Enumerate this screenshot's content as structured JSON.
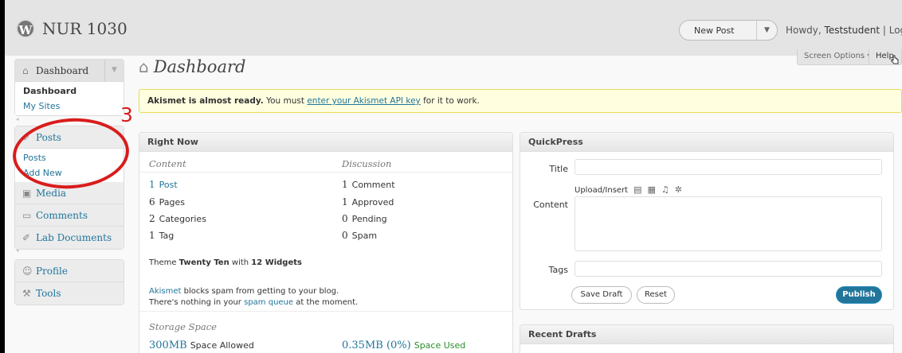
{
  "header": {
    "logo_glyph": "W",
    "site_name": "NUR 1030",
    "new_post_label": "New Post",
    "howdy_prefix": "Howdy, ",
    "username": "Teststudent",
    "logout_text": " | Log Ou"
  },
  "screen_options_label": "Screen Options ▾",
  "help_label": "Help",
  "sidebar": {
    "dashboard_label": "Dashboard",
    "dashboard_sub": [
      "Dashboard",
      "My Sites"
    ],
    "posts_label": "Posts",
    "posts_sub": [
      "Posts",
      "Add New"
    ],
    "media_label": "Media",
    "comments_label": "Comments",
    "lab_documents_label": "Lab Documents",
    "profile_label": "Profile",
    "tools_label": "Tools"
  },
  "page_title": "Dashboard",
  "notice": {
    "bold": "Akismet is almost ready.",
    "text1": " You must ",
    "link": "enter your Akismet API key",
    "text2": " for it to work."
  },
  "right_now": {
    "title": "Right Now",
    "content_heading": "Content",
    "discussion_heading": "Discussion",
    "content": [
      {
        "n": "1",
        "label": "Post"
      },
      {
        "n": "6",
        "label": "Pages"
      },
      {
        "n": "2",
        "label": "Categories"
      },
      {
        "n": "1",
        "label": "Tag"
      }
    ],
    "discussion": [
      {
        "n": "1",
        "label": "Comment"
      },
      {
        "n": "1",
        "label": "Approved"
      },
      {
        "n": "0",
        "label": "Pending"
      },
      {
        "n": "0",
        "label": "Spam"
      }
    ],
    "theme_prefix": "Theme ",
    "theme_name": "Twenty Ten",
    "theme_mid": " with ",
    "widgets": "12 Widgets",
    "akismet_link": "Akismet",
    "akismet_text": " blocks spam from getting to your blog.",
    "spam_line_pre": "There's nothing in your ",
    "spam_link": "spam queue",
    "spam_line_post": " at the moment.",
    "storage_heading": "Storage Space",
    "storage_allowed_n": "300MB",
    "storage_allowed_label": "Space Allowed",
    "storage_used_n": "0.35MB (0%)",
    "storage_used_label": "Space Used"
  },
  "quickpress": {
    "title": "QuickPress",
    "title_label": "Title",
    "upload_label": "Upload/Insert",
    "content_label": "Content",
    "tags_label": "Tags",
    "save_draft": "Save Draft",
    "reset": "Reset",
    "publish": "Publish"
  },
  "recent_drafts": {
    "title": "Recent Drafts"
  },
  "annotation": {
    "step_number": "3",
    "color": "#d91c1c"
  },
  "colors": {
    "link": "#21759b",
    "notice_bg": "#ffffe0",
    "publish_bg": "#21759b"
  }
}
